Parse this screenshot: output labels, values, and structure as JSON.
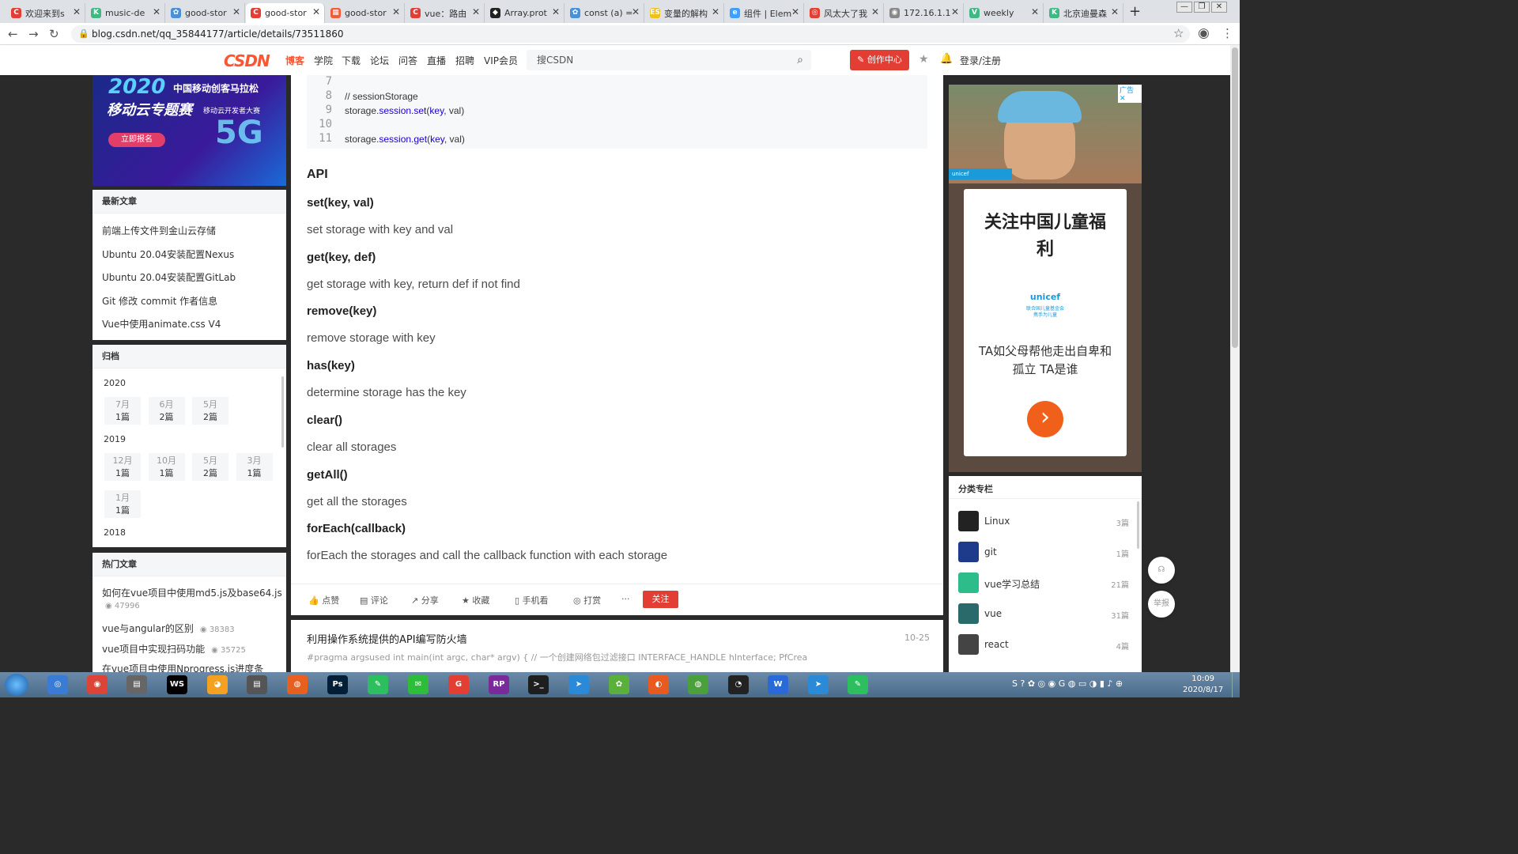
{
  "browser": {
    "tabs": [
      {
        "title": "欢迎来到s",
        "color": "#e33e33",
        "glyph": "C"
      },
      {
        "title": "music-de",
        "color": "#41b883",
        "glyph": "K"
      },
      {
        "title": "good-stor",
        "color": "#4a90d9",
        "glyph": "✿"
      },
      {
        "title": "good-stor",
        "color": "#e33e33",
        "glyph": "C"
      },
      {
        "title": "good-stor",
        "color": "#f45b3b",
        "glyph": "▦"
      },
      {
        "title": "vue：路由",
        "color": "#e33e33",
        "glyph": "C"
      },
      {
        "title": "Array.prot",
        "color": "#222",
        "glyph": "◆"
      },
      {
        "title": "const (a) =",
        "color": "#4a90d9",
        "glyph": "✿"
      },
      {
        "title": "变量的解构",
        "color": "#f0c020",
        "glyph": "ES"
      },
      {
        "title": "组件 | Elem",
        "color": "#409eff",
        "glyph": "e"
      },
      {
        "title": "风太大了我",
        "color": "#e33e33",
        "glyph": "◎"
      },
      {
        "title": "172.16.1.1",
        "color": "#888",
        "glyph": "◉"
      },
      {
        "title": "weekly",
        "color": "#41b883",
        "glyph": "V"
      },
      {
        "title": "北京迪曼森",
        "color": "#41b883",
        "glyph": "K"
      }
    ],
    "new_tab": "+",
    "url": "blog.csdn.net/qq_35844177/article/details/73511860"
  },
  "csdn_header": {
    "logo_main": "CSDN",
    "nav": [
      "博客",
      "学院",
      "下载",
      "论坛",
      "问答",
      "直播",
      "招聘",
      "VIP会员"
    ],
    "search_placeholder": "搜CSDN",
    "create_label": "创作中心",
    "login_label": "登录/注册"
  },
  "left_sidebar": {
    "banner": {
      "year": "2020",
      "line1": "中国移动创客马拉松",
      "line2": "移动云专题赛",
      "line3": "移动云开发者大赛",
      "cta": "立即报名",
      "badge": "5G"
    },
    "latest_title": "最新文章",
    "latest": [
      "前端上传文件到金山云存储",
      "Ubuntu 20.04安装配置Nexus",
      "Ubuntu 20.04安装配置GitLab",
      "Git 修改 commit 作者信息",
      "Vue中使用animate.css V4"
    ],
    "archive_title": "归档",
    "archive": [
      {
        "year": "2020",
        "months": [
          {
            "m": "7月",
            "c": "1篇"
          },
          {
            "m": "6月",
            "c": "2篇"
          },
          {
            "m": "5月",
            "c": "2篇"
          }
        ]
      },
      {
        "year": "2019",
        "months": [
          {
            "m": "12月",
            "c": "1篇"
          },
          {
            "m": "10月",
            "c": "1篇"
          },
          {
            "m": "5月",
            "c": "2篇"
          },
          {
            "m": "3月",
            "c": "1篇"
          },
          {
            "m": "1月",
            "c": "1篇"
          }
        ]
      },
      {
        "year": "2018",
        "months": []
      }
    ],
    "hot_title": "热门文章",
    "hot": [
      {
        "title": "如何在vue项目中使用md5.js及base64.js",
        "views": "47996"
      },
      {
        "title": "vue与angular的区别",
        "views": "38383"
      },
      {
        "title": "vue项目中实现扫码功能",
        "views": "35725"
      },
      {
        "title": "在vue项目中使用Nprogress.js进度条",
        "views": ""
      }
    ]
  },
  "article": {
    "code_lines": [
      {
        "n": "7",
        "text": ""
      },
      {
        "n": "8",
        "text": "// sessionStorage"
      },
      {
        "n": "9",
        "text": "storage.session.set(key, val)"
      },
      {
        "n": "10",
        "text": ""
      },
      {
        "n": "11",
        "text": "storage.session.get(key, val)"
      }
    ],
    "heading": "API",
    "items": [
      {
        "name": "set(key, val)",
        "desc": "set storage with key and val"
      },
      {
        "name": "get(key, def)",
        "desc": "get storage with key, return def if not find"
      },
      {
        "name": "remove(key)",
        "desc": "remove storage with key"
      },
      {
        "name": "has(key)",
        "desc": "determine storage has the key"
      },
      {
        "name": "clear()",
        "desc": "clear all storages"
      },
      {
        "name": "getAll()",
        "desc": "get all the storages"
      },
      {
        "name": "forEach(callback)",
        "desc": "forEach the storages and call the callback function with each storage"
      }
    ]
  },
  "toolbar": {
    "like": "点赞",
    "comment": "评论",
    "share": "分享",
    "collect": "收藏",
    "mobile": "手机看",
    "reward": "打赏",
    "more": "···",
    "follow": "关注"
  },
  "recommend": {
    "title": "利用操作系统提供的API编写防火墙",
    "date": "10-25",
    "snippet": "#pragma argsused int main(int argc, char* argv) { // 一个创建网络包过滤接口 INTERFACE_HANDLE hInterface; PfCrea"
  },
  "ad": {
    "label": "广告",
    "title": "关注中国儿童福利",
    "brand": "unicef",
    "brand_sub": "联合国儿童基金会",
    "brand_tag": "携手为儿童",
    "slogan": "TA如父母帮他走出自卑和孤立 TA是谁",
    "arrow": "›"
  },
  "columns": {
    "title": "分类专栏",
    "items": [
      {
        "name": "Linux",
        "count": "3篇",
        "color": "#222"
      },
      {
        "name": "git",
        "count": "1篇",
        "color": "#1d3b8a"
      },
      {
        "name": "vue学习总结",
        "count": "21篇",
        "color": "#2dbd8a"
      },
      {
        "name": "vue",
        "count": "31篇",
        "color": "#2a6a6a"
      },
      {
        "name": "react",
        "count": "4篇",
        "color": "#444"
      }
    ]
  },
  "float": {
    "service": "☊",
    "report": "举报"
  },
  "taskbar": {
    "time": "10:09",
    "date": "2020/8/17",
    "apps": [
      {
        "g": "◎",
        "c": "#3a7bd5"
      },
      {
        "g": "◉",
        "c": "#db4437"
      },
      {
        "g": "▤",
        "c": "#666"
      },
      {
        "g": "WS",
        "c": "#000"
      },
      {
        "g": "◕",
        "c": "#f4a020"
      },
      {
        "g": "▤",
        "c": "#555"
      },
      {
        "g": "◍",
        "c": "#e86020"
      },
      {
        "g": "Ps",
        "c": "#001e36"
      },
      {
        "g": "✎",
        "c": "#2dbe60"
      },
      {
        "g": "✉",
        "c": "#2dbd3a"
      },
      {
        "g": "G",
        "c": "#e33e33"
      },
      {
        "g": "RP",
        "c": "#7a2a9a"
      },
      {
        "g": ">_",
        "c": "#1e1e1e"
      },
      {
        "g": "➤",
        "c": "#2a8ad8"
      },
      {
        "g": "✿",
        "c": "#5ab03a"
      },
      {
        "g": "◐",
        "c": "#e85a20"
      },
      {
        "g": "◍",
        "c": "#4aa03a"
      },
      {
        "g": "◔",
        "c": "#222"
      },
      {
        "g": "W",
        "c": "#2a6ad8"
      },
      {
        "g": "➤",
        "c": "#2a8ad8"
      },
      {
        "g": "✎",
        "c": "#2dbe60"
      }
    ]
  }
}
